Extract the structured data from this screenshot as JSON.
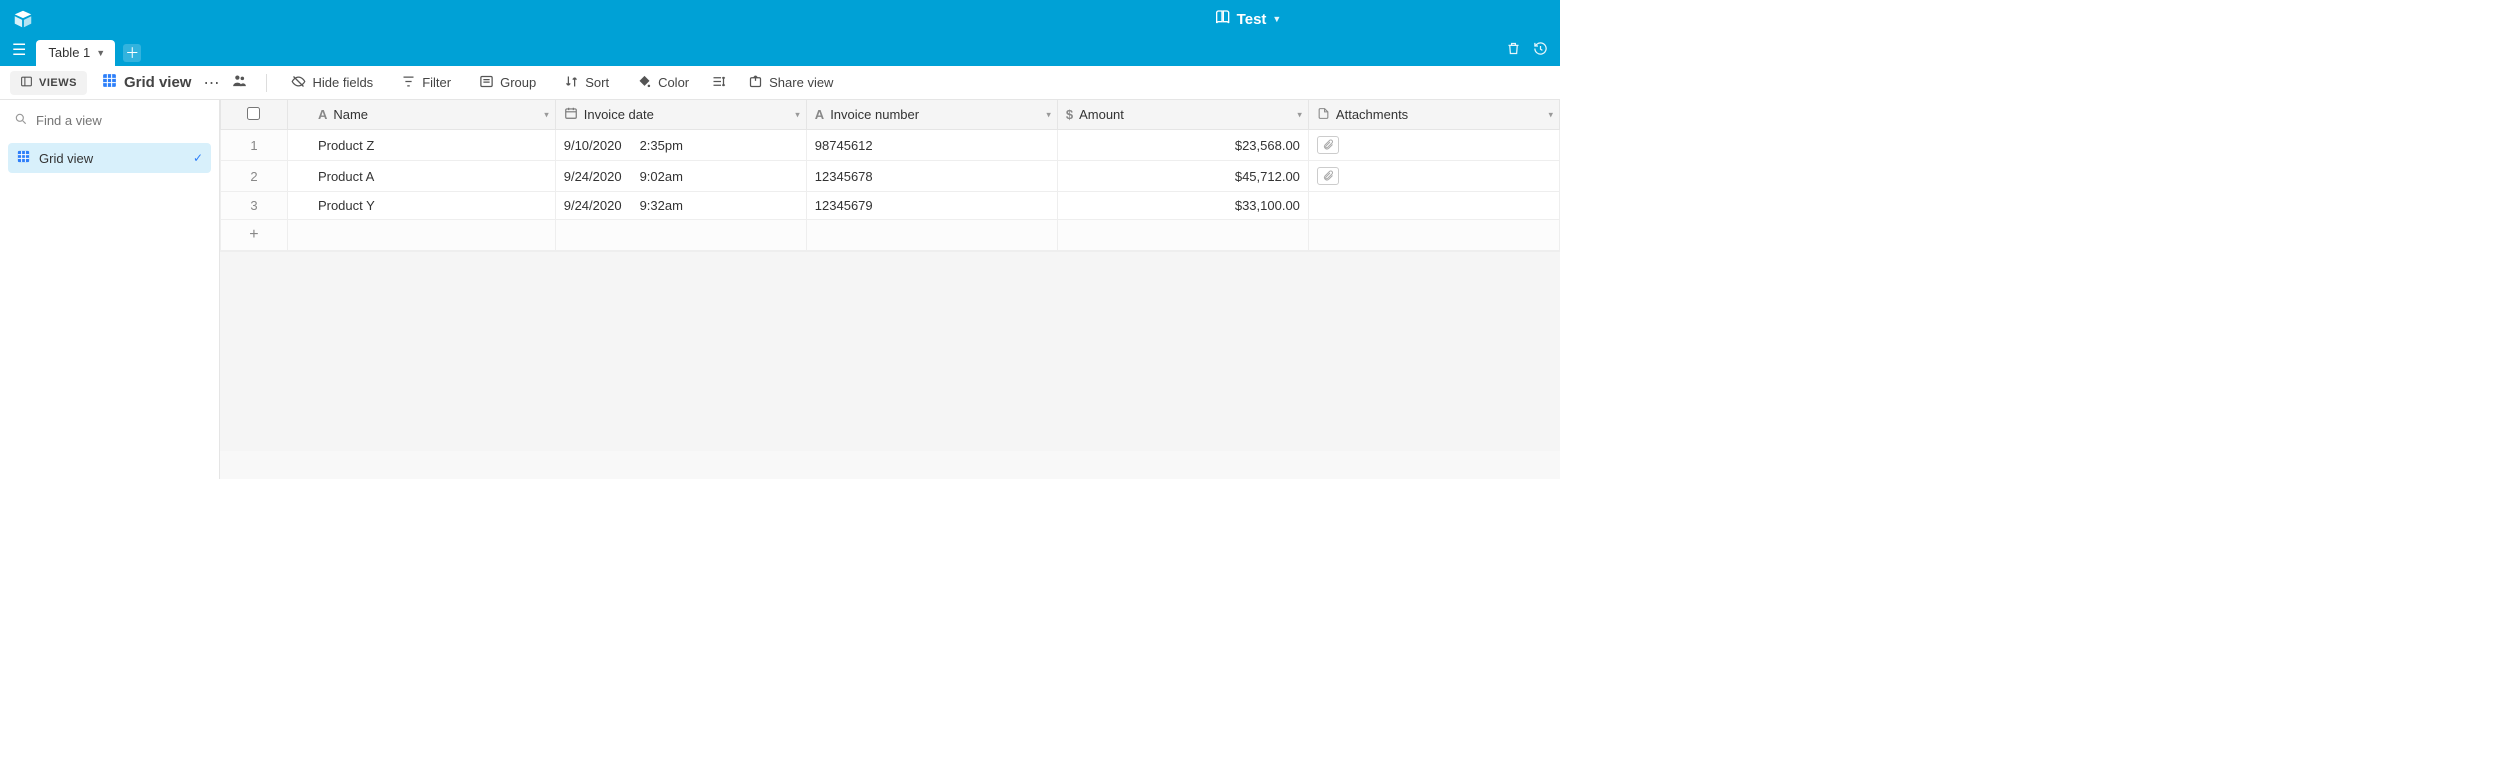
{
  "header": {
    "base_name": "Test"
  },
  "tabs": [
    {
      "label": "Table 1"
    }
  ],
  "toolbar": {
    "views_label": "VIEWS",
    "view_name": "Grid view",
    "hide_fields": "Hide fields",
    "filter": "Filter",
    "group": "Group",
    "sort": "Sort",
    "color": "Color",
    "share_view": "Share view"
  },
  "sidebar": {
    "search_placeholder": "Find a view",
    "items": [
      {
        "label": "Grid view",
        "active": true
      }
    ]
  },
  "columns": [
    {
      "key": "name",
      "label": "Name",
      "type": "text"
    },
    {
      "key": "invoice_date",
      "label": "Invoice date",
      "type": "date"
    },
    {
      "key": "invoice_number",
      "label": "Invoice number",
      "type": "text"
    },
    {
      "key": "amount",
      "label": "Amount",
      "type": "currency"
    },
    {
      "key": "attachments",
      "label": "Attachments",
      "type": "attachment"
    }
  ],
  "rows": [
    {
      "num": "1",
      "name": "Product Z",
      "invoice_date_day": "9/10/2020",
      "invoice_date_time": "2:35pm",
      "invoice_number": "98745612",
      "amount": "$23,568.00",
      "has_attachment": true
    },
    {
      "num": "2",
      "name": "Product A",
      "invoice_date_day": "9/24/2020",
      "invoice_date_time": "9:02am",
      "invoice_number": "12345678",
      "amount": "$45,712.00",
      "has_attachment": true
    },
    {
      "num": "3",
      "name": "Product Y",
      "invoice_date_day": "9/24/2020",
      "invoice_date_time": "9:32am",
      "invoice_number": "12345679",
      "amount": "$33,100.00",
      "has_attachment": false
    }
  ]
}
